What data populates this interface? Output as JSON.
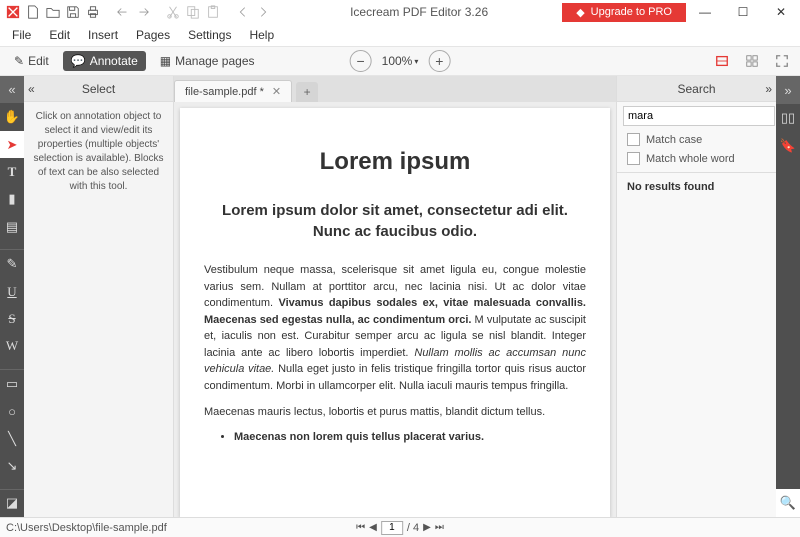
{
  "titlebar": {
    "title": "Icecream PDF Editor 3.26",
    "upgrade": "Upgrade to PRO"
  },
  "menu": [
    "File",
    "Edit",
    "Insert",
    "Pages",
    "Settings",
    "Help"
  ],
  "modes": {
    "edit": "Edit",
    "annotate": "Annotate",
    "manage": "Manage pages"
  },
  "zoom": "100%",
  "leftPanel": {
    "title": "Select",
    "help": "Click on annotation object to select it and view/edit its properties (multiple objects' selection is available). Blocks of text can be also selected with this tool."
  },
  "tab": {
    "name": "file-sample.pdf *"
  },
  "doc": {
    "h1": "Lorem ipsum",
    "h2": "Lorem ipsum dolor sit amet, consectetur adi elit. Nunc ac faucibus odio.",
    "p1a": "Vestibulum neque massa, scelerisque sit amet ligula eu, congue molestie varius sem. Nullam at porttitor arcu, nec lacinia nisi. Ut ac dolor vitae condimentum. ",
    "p1b": "Vivamus dapibus sodales ex, vitae malesuada convallis. Maecenas sed egestas nulla, ac condimentum orci.",
    "p1c": " M vulputate ac suscipit et, iaculis non est. Curabitur semper arcu ac ligula se nisl blandit. Integer lacinia ante ac libero lobortis imperdiet. ",
    "p1d": "Nullam mollis ac accumsan nunc vehicula vitae.",
    "p1e": " Nulla eget justo in felis tristique fringilla tortor quis risus auctor condimentum. Morbi in ullamcorper elit. Nulla iaculi mauris tempus fringilla.",
    "p2": "Maecenas mauris lectus, lobortis et purus mattis, blandit dictum tellus.",
    "li1": "Maecenas non lorem quis tellus placerat varius."
  },
  "search": {
    "title": "Search",
    "value": "mara",
    "matchCase": "Match case",
    "matchWord": "Match whole word",
    "noResults": "No results found"
  },
  "status": {
    "path": "C:\\Users\\Desktop\\file-sample.pdf",
    "page": "1",
    "total": "/ 4"
  }
}
